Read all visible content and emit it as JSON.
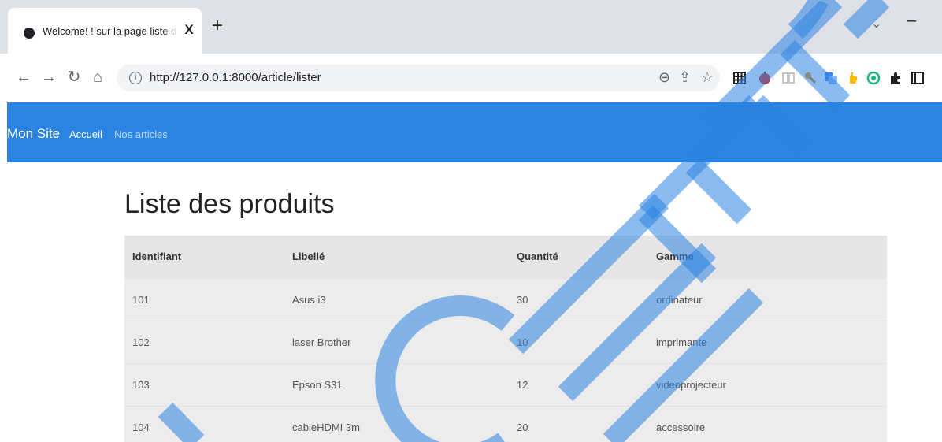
{
  "browser": {
    "tab_title": "Welcome! ! sur la page liste des articles",
    "tab_close": "X",
    "new_tab": "+",
    "tab_search": "⌄",
    "minimize": "–",
    "url": "http://127.0.0.1:8000/article/lister",
    "icons": [
      "back-arrow-icon",
      "forward-arrow-icon",
      "reload-icon",
      "home-icon",
      "info-icon",
      "zoom-icon",
      "share-icon",
      "star-icon"
    ]
  },
  "navbar": {
    "brand": "Mon Site",
    "links": [
      "Accueil",
      "Nos articles"
    ],
    "color": "#2b84e1"
  },
  "main": {
    "title": "Liste des produits",
    "table": {
      "headers": [
        "Identifiant",
        "Libellé",
        "Quantité",
        "Gamme"
      ],
      "rows": [
        [
          "101",
          "Asus i3",
          "30",
          "ordinateur"
        ],
        [
          "102",
          "laser Brother",
          "10",
          "imprimante"
        ],
        [
          "103",
          "Epson S31",
          "12",
          "videoprojecteur"
        ],
        [
          "104",
          "cableHDMI 3m",
          "20",
          "accessoire"
        ]
      ]
    }
  },
  "watermark": {
    "text": "CHERI",
    "color": "#2b84e1"
  }
}
